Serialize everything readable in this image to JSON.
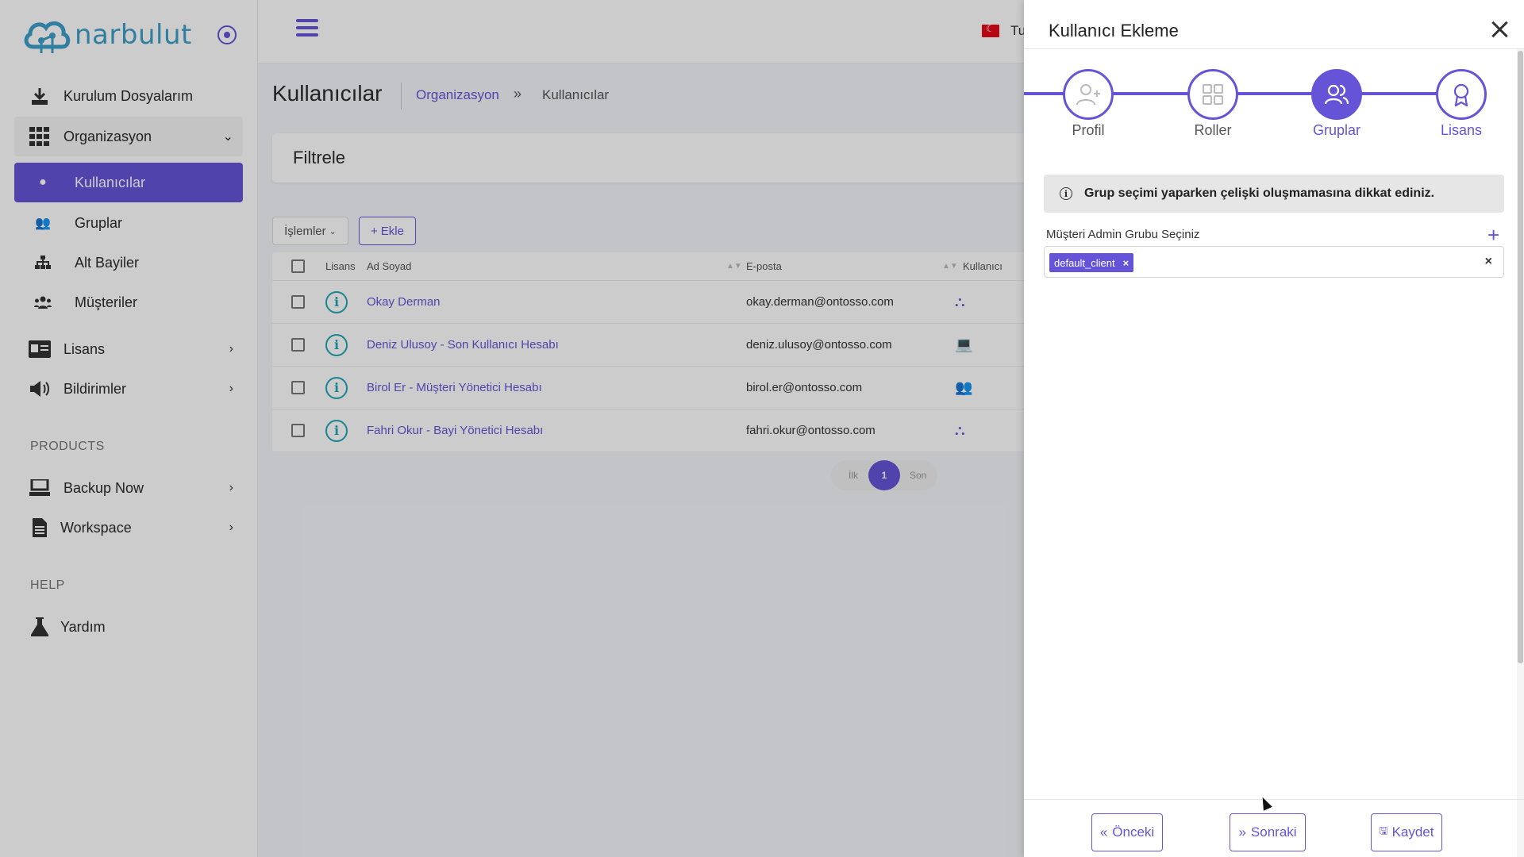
{
  "sidebar": {
    "brand": "narbulut",
    "items": [
      {
        "label": "Kurulum Dosyalarım",
        "icon": "download-icon"
      },
      {
        "label": "Organizasyon",
        "icon": "grid-icon"
      },
      {
        "label": "Lisans",
        "icon": "id-card-icon"
      },
      {
        "label": "Bildirimler",
        "icon": "megaphone-icon"
      }
    ],
    "sub_items": [
      {
        "label": "Kullanıcılar",
        "icon": "user-icon"
      },
      {
        "label": "Gruplar",
        "icon": "users-icon"
      },
      {
        "label": "Alt Bayiler",
        "icon": "sitemap-icon"
      },
      {
        "label": "Müşteriler",
        "icon": "people-group-icon"
      }
    ],
    "section_products": "PRODUCTS",
    "products": [
      {
        "label": "Backup Now",
        "icon": "computer-icon"
      },
      {
        "label": "Workspace",
        "icon": "document-icon"
      }
    ],
    "section_help": "HELP",
    "help": [
      {
        "label": "Yardım",
        "icon": "flask-icon"
      }
    ]
  },
  "topbar": {
    "language": "Tu"
  },
  "page": {
    "title": "Kullanıcılar",
    "breadcrumb": [
      "Organizasyon",
      "Kullanıcılar"
    ],
    "filter_title": "Filtrele",
    "ops_button": "İşlemler",
    "add_button": "Ekle",
    "columns": [
      "Lisans",
      "Ad Soyad",
      "E-posta",
      "Kullanıcı"
    ],
    "rows": [
      {
        "name": "Okay Derman",
        "email": "okay.derman@ontosso.com",
        "type_icon": "sitemap-icon"
      },
      {
        "name": "Deniz Ulusoy - Son Kullanıcı Hesabı",
        "email": "deniz.ulusoy@ontosso.com",
        "type_icon": "laptop-icon"
      },
      {
        "name": "Birol Er - Müşteri Yönetici Hesabı",
        "email": "birol.er@ontosso.com",
        "type_icon": "people-group-icon"
      },
      {
        "name": "Fahri Okur - Bayi Yönetici Hesabı",
        "email": "fahri.okur@ontosso.com",
        "type_icon": "sitemap-icon"
      }
    ],
    "pager": {
      "first": "İlk",
      "current": "1",
      "last": "Son"
    }
  },
  "drawer": {
    "title": "Kullanıcı Ekleme",
    "steps": [
      {
        "label": "Profil",
        "icon": "user-plus-icon"
      },
      {
        "label": "Roller",
        "icon": "grid-icon"
      },
      {
        "label": "Gruplar",
        "icon": "users-icon"
      },
      {
        "label": "Lisans",
        "icon": "award-icon"
      }
    ],
    "active_step": "Gruplar",
    "alert": "Grup seçimi yaparken çelişki oluşmamasına dikkat ediniz.",
    "field_label": "Müşteri Admin Grubu Seçiniz",
    "selected_tag": "default_client",
    "buttons": {
      "prev": "Önceki",
      "next": "Sonraki",
      "save": "Kaydet"
    }
  },
  "colors": {
    "accent": "#6554d8",
    "info": "#1fa7b5",
    "brand": "#3d9fc9"
  }
}
